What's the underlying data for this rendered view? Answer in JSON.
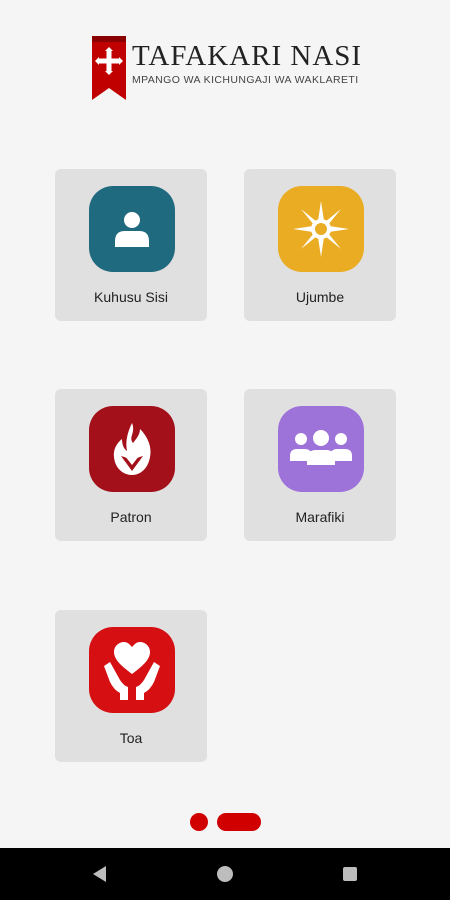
{
  "header": {
    "title": "TAFAKARI NASI",
    "subtitle": "MPANGO WA KICHUNGAJI WA WAKLARETI",
    "logo_icon": "cross-shield-icon",
    "logo_color": "#c00000"
  },
  "tiles": [
    {
      "label": "Kuhusu Sisi",
      "icon": "person-icon",
      "color": "#1f6a7e"
    },
    {
      "label": "Ujumbe",
      "icon": "sun-icon",
      "color": "#e9ac23"
    },
    {
      "label": "Patron",
      "icon": "flame-icon",
      "color": "#a3101a"
    },
    {
      "label": "Marafiki",
      "icon": "group-icon",
      "color": "#9d72d9"
    },
    {
      "label": "Toa",
      "icon": "heart-hands-icon",
      "color": "#d60f12"
    }
  ],
  "pager": {
    "active_color": "#d10000",
    "inactive_color": "#d10000"
  },
  "navbar": {
    "back": "back-icon",
    "home": "home-icon",
    "recents": "recents-icon"
  }
}
